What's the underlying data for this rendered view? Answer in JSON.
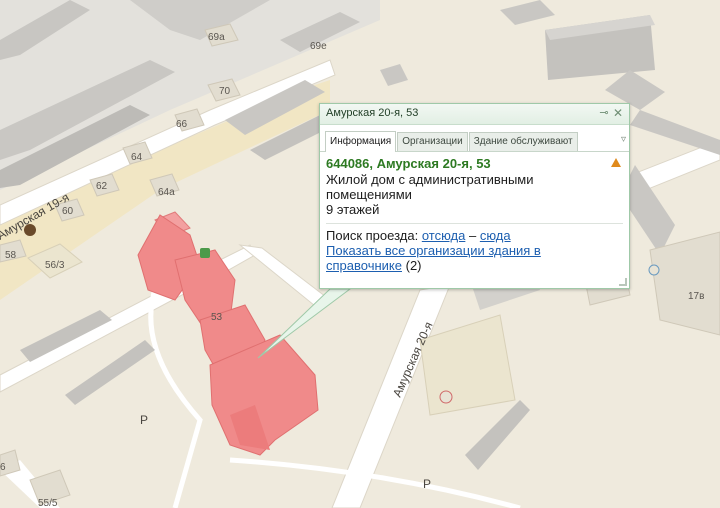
{
  "map": {
    "house_labels": {
      "h69a": "69a",
      "h69e": "69е",
      "h70": "70",
      "h66": "66",
      "h64": "64",
      "h62": "62",
      "h64a": "64а",
      "h60": "60",
      "h58": "58",
      "h563": "56/3",
      "h53": "53",
      "h17v": "17в",
      "h555": "55/5",
      "h6": "6"
    },
    "streets": {
      "amurskaya19": "Амурская 19-я",
      "amurskaya20": "Амурская 20-я"
    },
    "parking": [
      "P",
      "P"
    ],
    "colors": {
      "ground": "#efeadd",
      "road": "#ffffff",
      "building": "#d4d0c8",
      "highlight": "#f08080"
    }
  },
  "popup": {
    "title": "Амурская 20-я, 53",
    "pin_icon": "pin-icon",
    "close_icon": "close-icon",
    "tabs": [
      {
        "label": "Информация",
        "active": true
      },
      {
        "label": "Организации",
        "active": false
      },
      {
        "label": "Здание обслуживают",
        "active": false
      }
    ],
    "tabs_more_icon": "chevron-down-icon",
    "address": "644086, Амурская 20-я, 53",
    "description": [
      "Жилой дом с административными",
      "помещениями",
      "9 этажей"
    ],
    "route": {
      "label": "Поиск проезда:",
      "from": "отсюда",
      "dash": "–",
      "to": "сюда"
    },
    "orgs_link": [
      "Показать все организации здания в",
      "справочнике"
    ],
    "orgs_count": "(2)"
  }
}
